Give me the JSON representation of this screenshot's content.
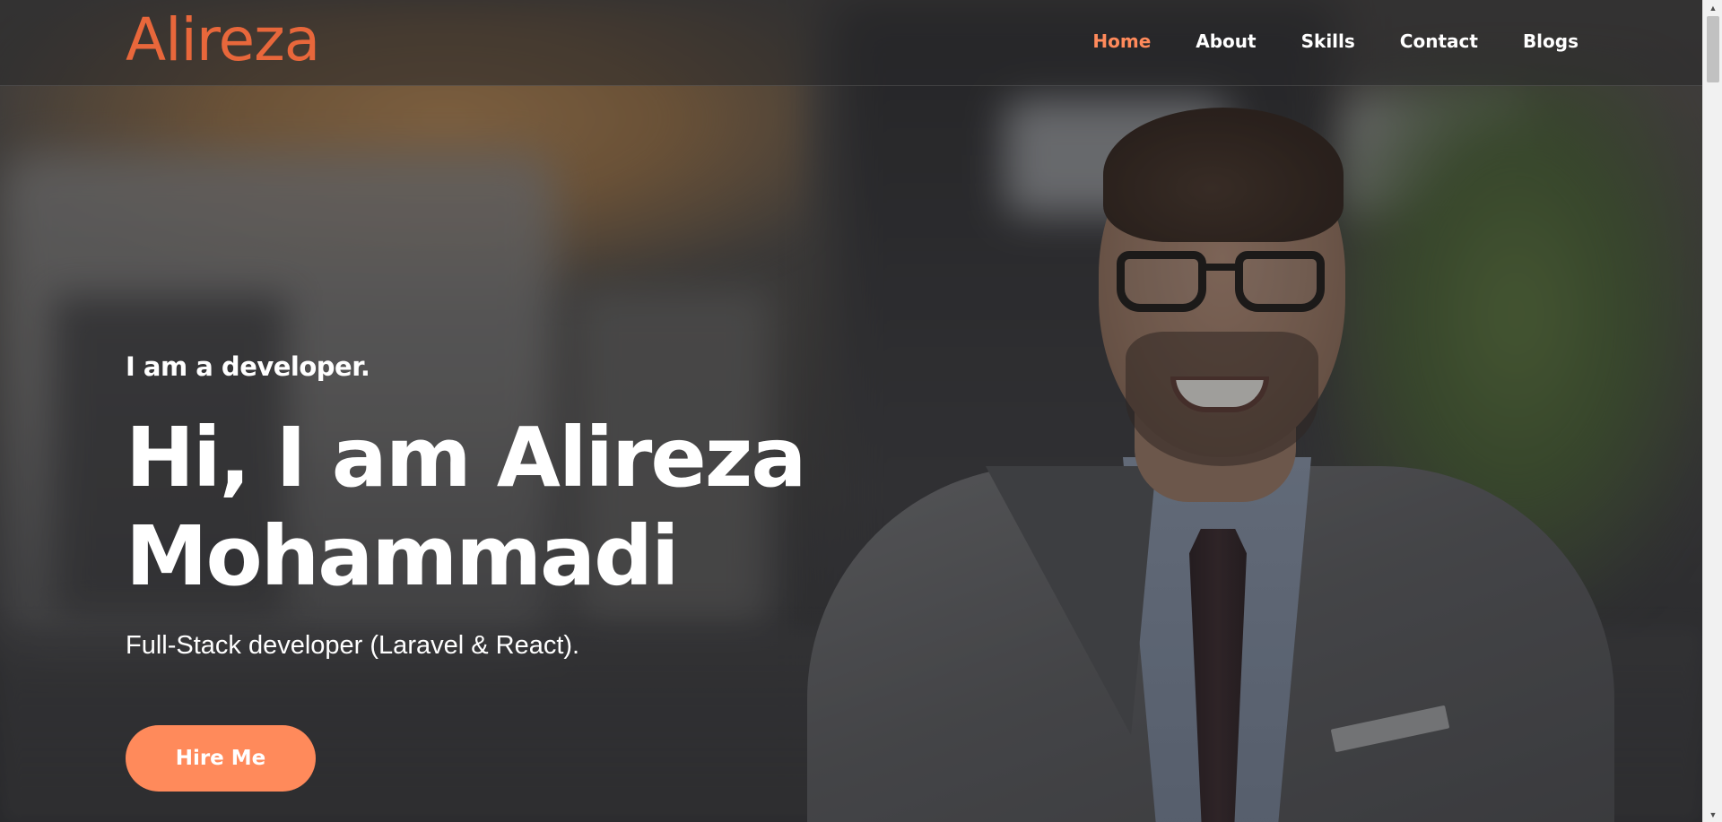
{
  "header": {
    "logo": "Alireza",
    "nav": [
      {
        "label": "Home",
        "active": true
      },
      {
        "label": "About",
        "active": false
      },
      {
        "label": "Skills",
        "active": false
      },
      {
        "label": "Contact",
        "active": false
      },
      {
        "label": "Blogs",
        "active": false
      }
    ]
  },
  "hero": {
    "kicker": "I am a developer.",
    "title_line1": "Hi, I am Alireza",
    "title_line2": "Mohammadi",
    "subtitle": "Full-Stack developer (Laravel & React).",
    "cta_label": "Hire Me"
  },
  "colors": {
    "accent": "#ff8a5b",
    "logo": "#e8673b",
    "text": "#ffffff"
  },
  "scrollbar": {
    "up_icon": "chevron-up-icon",
    "down_icon": "chevron-down-icon"
  }
}
